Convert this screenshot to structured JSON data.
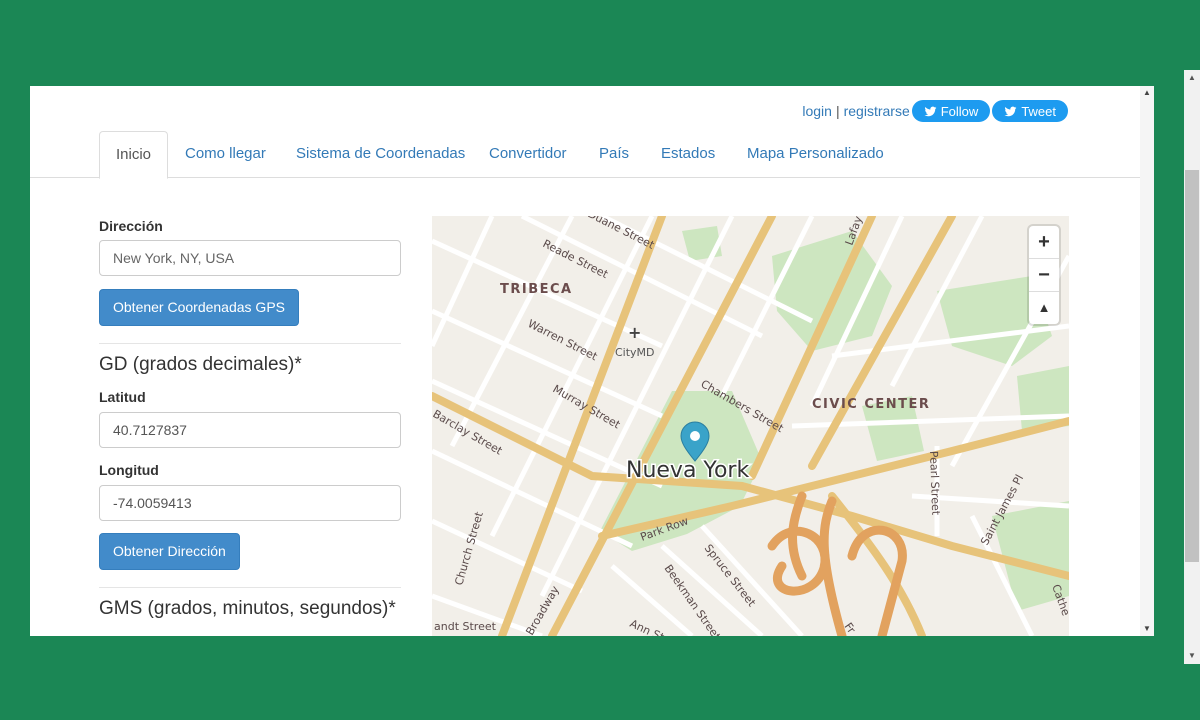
{
  "header": {
    "login": "login",
    "separator": "|",
    "register": "registrarse",
    "follow": "Follow",
    "tweet": "Tweet"
  },
  "tabs": [
    {
      "label": "Inicio"
    },
    {
      "label": "Como llegar"
    },
    {
      "label": "Sistema de Coordenadas"
    },
    {
      "label": "Convertidor"
    },
    {
      "label": "País"
    },
    {
      "label": "Estados"
    },
    {
      "label": "Mapa Personalizado"
    }
  ],
  "form": {
    "address_label": "Dirección",
    "address_value": "New York, NY, USA",
    "get_gps_button": "Obtener Coordenadas GPS",
    "gd_heading": "GD (grados decimales)*",
    "lat_label": "Latitud",
    "lat_value": "40.7127837",
    "lng_label": "Longitud",
    "lng_value": "-74.0059413",
    "get_address_button": "Obtener Dirección",
    "gms_heading": "GMS (grados, minutos, segundos)*"
  },
  "map": {
    "zoom_in": "+",
    "zoom_out": "−",
    "reset": "▲",
    "labels": {
      "tribeca": "TRIBECA",
      "civic_center": "CIVIC CENTER",
      "city": "Nueva York",
      "citymd": "CityMD",
      "reade": "Reade Street",
      "duane": "Duane Street",
      "warren": "Warren Street",
      "murray": "Murray Street",
      "barclay": "Barclay Street",
      "chambers": "Chambers Street",
      "church": "Church Street",
      "park_row": "Park Row",
      "spruce": "Spruce Street",
      "beekman": "Beekman Street",
      "ann": "Ann Street",
      "broadway": "Broadway",
      "pearl": "Pearl Street",
      "st_james": "Saint James Pl",
      "vandt": "andt Street",
      "lafayette": "Lafay",
      "catherine": "Cathe",
      "frankfort": "Fr"
    },
    "colors": {
      "major_road": "#e7c37a",
      "park": "#cde6c0",
      "marker": "#3aa3c9",
      "base": "#f2efe9"
    }
  }
}
